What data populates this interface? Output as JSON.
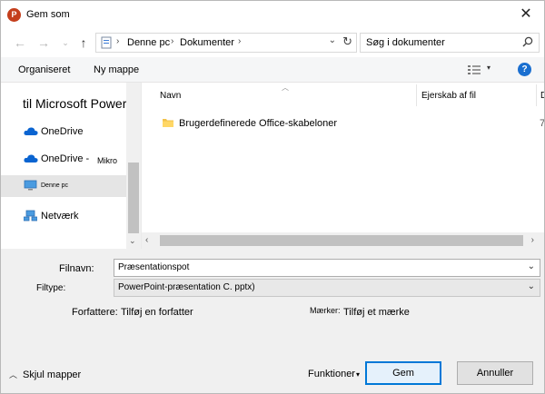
{
  "window": {
    "title": "Gem som",
    "app_icon_letter": "P"
  },
  "address": {
    "crumbs": [
      "Denne pc",
      "Dokumenter"
    ]
  },
  "search": {
    "placeholder": "Søg i dokumenter"
  },
  "toolbar": {
    "organize_label": "Organiseret",
    "new_folder_label": "Ny mappe",
    "help_label": "?"
  },
  "nav": {
    "items": [
      {
        "label": "til Microsoft PowerPC",
        "icon": "powerpoint-heading"
      },
      {
        "label": "OneDrive",
        "icon": "cloud-icon"
      },
      {
        "label": "OneDrive -",
        "suffix": "Mikro",
        "icon": "cloud-icon"
      },
      {
        "label": "Denne pc",
        "icon": "computer-icon",
        "selected": true
      },
      {
        "label": "Netværk",
        "icon": "network-icon"
      }
    ]
  },
  "filelist": {
    "columns": [
      "Navn",
      "Ejerskab af fil",
      "D"
    ],
    "rows": [
      {
        "name": "Brugerdefinerede Office-skabeloner",
        "extra": "7",
        "icon": "folder-icon"
      }
    ]
  },
  "form": {
    "filename_label": "Filnavn:",
    "filename_value": "Præsentationspot",
    "filetype_label": "Filtype:",
    "filetype_value": "PowerPoint-præsentation C. pptx)",
    "authors_label": "Forfattere:",
    "authors_value": "Tilføj en forfatter",
    "tags_label": "Mærker:",
    "tags_value": "Tilføj et mærke"
  },
  "footer": {
    "hide_folders_label": "Skjul mapper",
    "tools_label": "Funktioner",
    "save_label": "Gem",
    "cancel_label": "Annuller"
  },
  "colors": {
    "accent": "#0078d7",
    "powerpoint": "#c43e1c",
    "onedrive": "#0a64d1",
    "folder": "#f2c24a"
  }
}
